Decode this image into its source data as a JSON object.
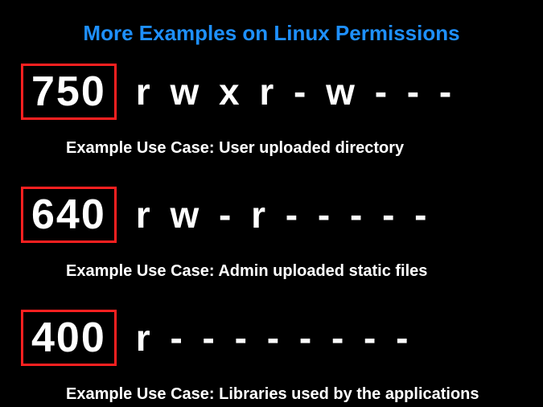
{
  "title": "More Examples on Linux Permissions",
  "examples": [
    {
      "octal": "750",
      "perm": "r w x r - w - - -",
      "caption": "Example Use Case: User uploaded directory"
    },
    {
      "octal": "640",
      "perm": "r w - r - - - - -",
      "caption": "Example Use Case: Admin uploaded static files"
    },
    {
      "octal": "400",
      "perm": "r - - - - - - - -",
      "caption": "Example Use Case: Libraries used by the applications"
    }
  ]
}
